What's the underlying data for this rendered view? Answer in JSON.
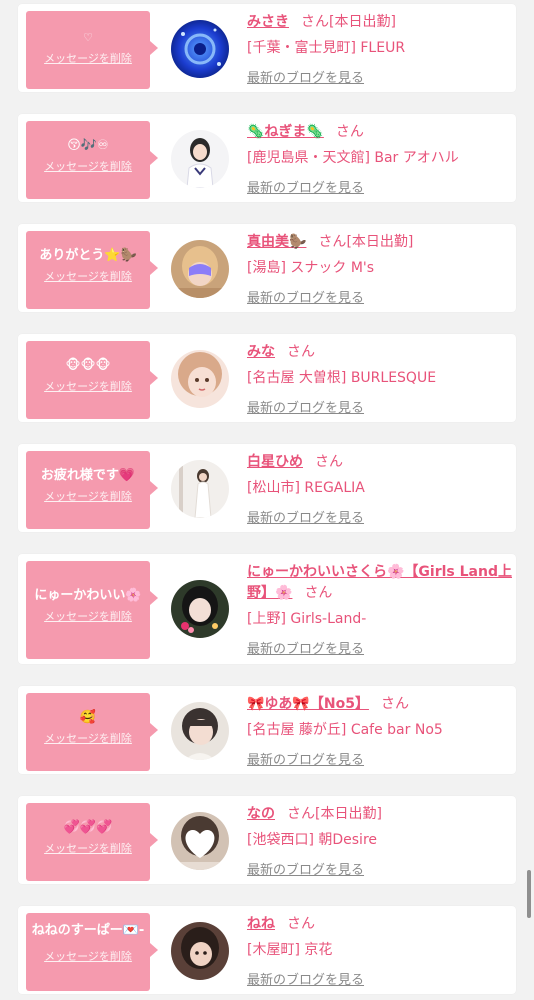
{
  "delete_label": "メッセージを削除",
  "blog_label": "最新のブログを見る",
  "san_label": "さん",
  "items": [
    {
      "message": "♡",
      "name": "みさき",
      "status": "[本日出勤]",
      "shop": "[千葉・富士見町] FLEUR"
    },
    {
      "message": "😚🎶♾",
      "name": "🦠ねぎま🦠",
      "status": "",
      "shop": "[鹿児島県・天文館] Bar アオハル"
    },
    {
      "message": "ありがとう⭐️🦫",
      "name": "真由美🦫",
      "status": "[本日出勤]",
      "shop": "[湯島] スナック M's"
    },
    {
      "message": "🐵🐵🐵",
      "name": "みな",
      "status": "",
      "shop": "[名古屋 大曽根] BURLESQUE"
    },
    {
      "message": "お疲れ様です💗",
      "name": "白星ひめ",
      "status": "",
      "shop": "[松山市] REGALIA"
    },
    {
      "message": "にゅーかわいい🌸",
      "name": "にゅーかわいいさくら🌸【Girls Land上野】🌸",
      "status": "",
      "shop": "[上野] Girls-Land-"
    },
    {
      "message": "🥰",
      "name": "🎀ゆあ🎀【No5】",
      "status": "",
      "shop": "[名古屋 藤が丘] Cafe bar No5"
    },
    {
      "message": "💞💞💞",
      "name": "なの",
      "status": "[本日出勤]",
      "shop": "[池袋西口] 朝Desire"
    },
    {
      "message": "ねねのすーぱー💌-",
      "name": "ねね",
      "status": "",
      "shop": "[木屋町] 京花"
    }
  ]
}
